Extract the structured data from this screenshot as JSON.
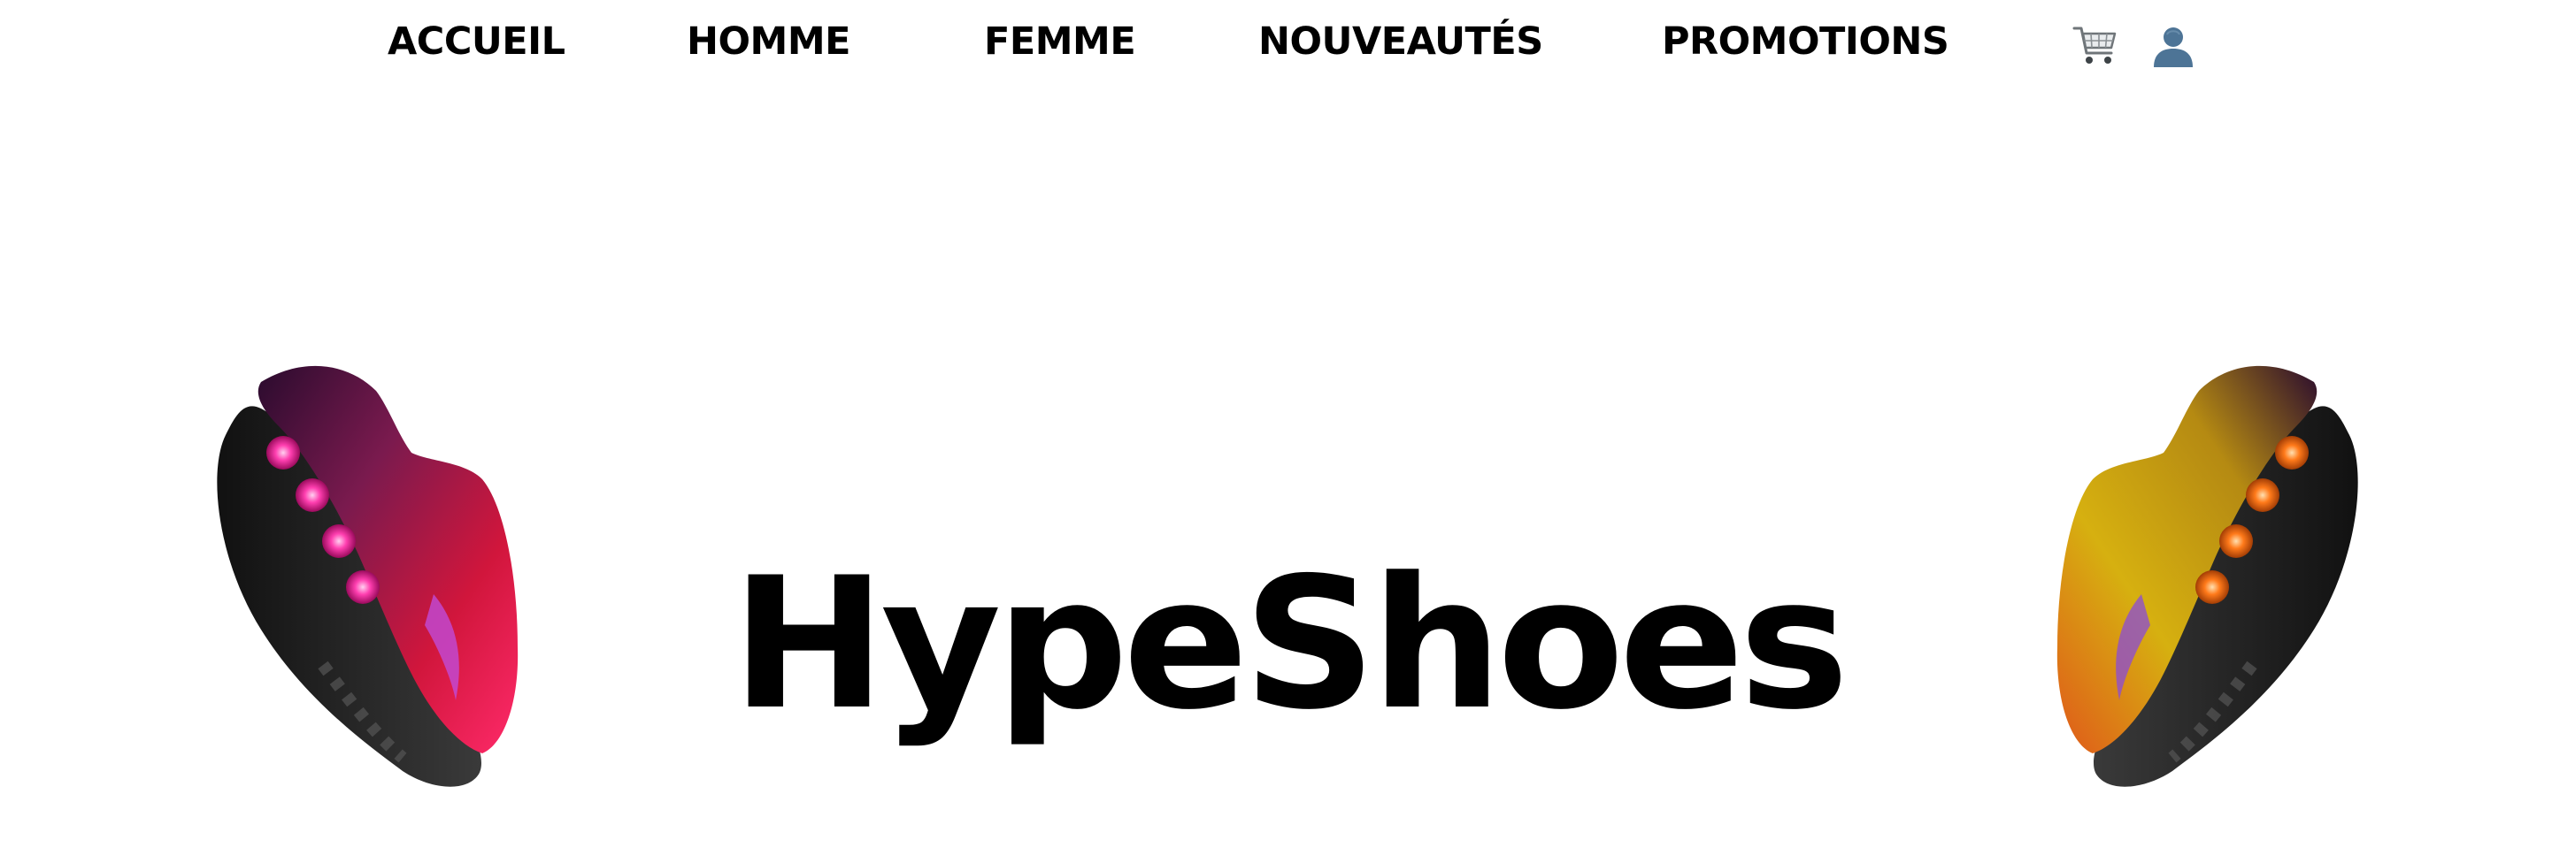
{
  "nav": {
    "links": [
      {
        "label": "ACCUEIL"
      },
      {
        "label": "HOMME"
      },
      {
        "label": "FEMME"
      },
      {
        "label": "NOUVEAUTÉS"
      },
      {
        "label": "PROMOTIONS"
      }
    ],
    "icons": {
      "cart": "shopping-cart-icon",
      "user": "user-account-icon"
    }
  },
  "hero": {
    "brand": "HypeShoes",
    "left_shoe": {
      "accent_colors": [
        "#ff1f8f",
        "#c4103a",
        "#2a0b2e"
      ]
    },
    "right_shoe": {
      "accent_colors": [
        "#ff7a1a",
        "#d6b010",
        "#2a0b2e"
      ]
    }
  },
  "colors": {
    "background": "#ffffff",
    "text": "#000000"
  }
}
